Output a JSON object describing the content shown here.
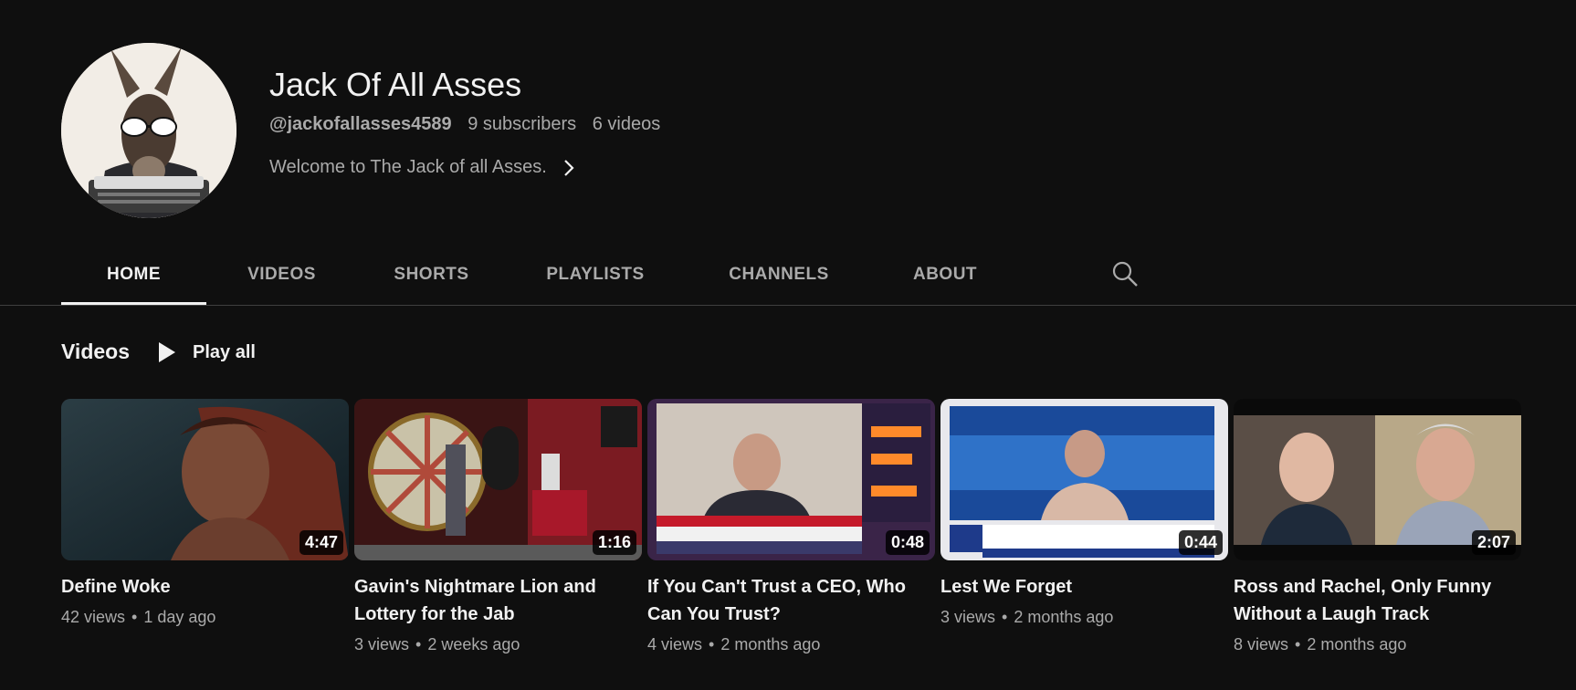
{
  "channel": {
    "name": "Jack Of All Asses",
    "handle": "@jackofallasses4589",
    "subscribers": "9 subscribers",
    "video_count": "6 videos",
    "description": "Welcome to The Jack of all Asses."
  },
  "tabs": [
    {
      "label": "HOME",
      "active": true
    },
    {
      "label": "VIDEOS"
    },
    {
      "label": "SHORTS"
    },
    {
      "label": "PLAYLISTS"
    },
    {
      "label": "CHANNELS"
    },
    {
      "label": "ABOUT"
    }
  ],
  "icons": {
    "search": "search-icon",
    "play": "play-icon",
    "chevron": "chevron-right-icon"
  },
  "section": {
    "title": "Videos",
    "play_all": "Play all"
  },
  "videos": [
    {
      "title": "Define Woke",
      "duration": "4:47",
      "views": "42 views",
      "age": "1 day ago"
    },
    {
      "title": "Gavin's Nightmare Lion and Lottery for the Jab",
      "duration": "1:16",
      "views": "3 views",
      "age": "2 weeks ago"
    },
    {
      "title": "If You Can't Trust a CEO, Who Can You Trust?",
      "duration": "0:48",
      "views": "4 views",
      "age": "2 months ago"
    },
    {
      "title": "Lest We Forget",
      "duration": "0:44",
      "views": "3 views",
      "age": "2 months ago"
    },
    {
      "title": "Ross and Rachel, Only Funny Without a Laugh Track",
      "duration": "2:07",
      "views": "8 views",
      "age": "2 months ago"
    }
  ],
  "colors": {
    "background": "#0f0f0f",
    "primary_text": "#f1f1f1",
    "secondary_text": "#aaaaaa",
    "divider": "#3f3f3f"
  }
}
